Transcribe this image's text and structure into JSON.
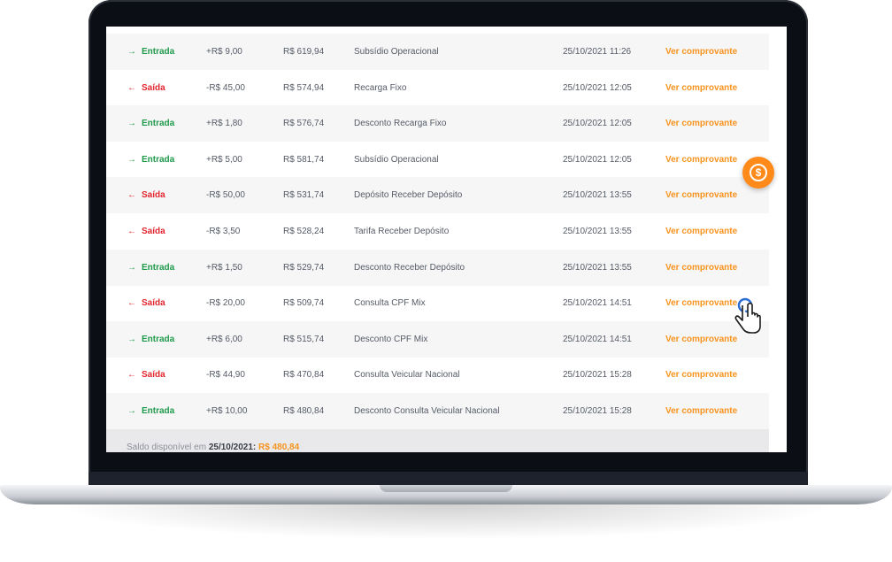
{
  "transactions": [
    {
      "type": "Entrada",
      "direction": "in",
      "arrow": "→",
      "value": "+R$ 9,00",
      "balance": "R$ 619,94",
      "description": "Subsídio Operacional",
      "date": "25/10/2021 11:26",
      "link": "Ver comprovante"
    },
    {
      "type": "Saída",
      "direction": "out",
      "arrow": "←",
      "value": "-R$ 45,00",
      "balance": "R$ 574,94",
      "description": "Recarga Fixo",
      "date": "25/10/2021 12:05",
      "link": "Ver comprovante"
    },
    {
      "type": "Entrada",
      "direction": "in",
      "arrow": "→",
      "value": "+R$ 1,80",
      "balance": "R$ 576,74",
      "description": "Desconto Recarga Fixo",
      "date": "25/10/2021 12:05",
      "link": "Ver comprovante"
    },
    {
      "type": "Entrada",
      "direction": "in",
      "arrow": "→",
      "value": "+R$ 5,00",
      "balance": "R$ 581,74",
      "description": "Subsídio Operacional",
      "date": "25/10/2021 12:05",
      "link": "Ver comprovante"
    },
    {
      "type": "Saída",
      "direction": "out",
      "arrow": "←",
      "value": "-R$ 50,00",
      "balance": "R$ 531,74",
      "description": "Depósito Receber Depósito",
      "date": "25/10/2021 13:55",
      "link": "Ver comprovante"
    },
    {
      "type": "Saída",
      "direction": "out",
      "arrow": "←",
      "value": "-R$ 3,50",
      "balance": "R$ 528,24",
      "description": "Tarifa Receber Depósito",
      "date": "25/10/2021 13:55",
      "link": "Ver comprovante"
    },
    {
      "type": "Entrada",
      "direction": "in",
      "arrow": "→",
      "value": "+R$ 1,50",
      "balance": "R$ 529,74",
      "description": "Desconto Receber Depósito",
      "date": "25/10/2021 13:55",
      "link": "Ver comprovante"
    },
    {
      "type": "Saída",
      "direction": "out",
      "arrow": "←",
      "value": "-R$ 20,00",
      "balance": "R$ 509,74",
      "description": "Consulta CPF Mix",
      "date": "25/10/2021 14:51",
      "link": "Ver comprovante"
    },
    {
      "type": "Entrada",
      "direction": "in",
      "arrow": "→",
      "value": "+R$ 6,00",
      "balance": "R$ 515,74",
      "description": "Desconto CPF Mix",
      "date": "25/10/2021 14:51",
      "link": "Ver comprovante"
    },
    {
      "type": "Saída",
      "direction": "out",
      "arrow": "←",
      "value": "-R$ 44,90",
      "balance": "R$ 470,84",
      "description": "Consulta Veicular Nacional",
      "date": "25/10/2021 15:28",
      "link": "Ver comprovante"
    },
    {
      "type": "Entrada",
      "direction": "in",
      "arrow": "→",
      "value": "+R$ 10,00",
      "balance": "R$ 480,84",
      "description": "Desconto Consulta Veicular Nacional",
      "date": "25/10/2021 15:28",
      "link": "Ver comprovante"
    }
  ],
  "footer": {
    "label": "Saldo disponível em ",
    "date": "25/10/2021",
    "separator": ": ",
    "amount": "R$ 480,84"
  },
  "fab": {
    "icon": "dollar-icon",
    "glyph": "$"
  },
  "colors": {
    "accent": "#f7931e",
    "in": "#1f9a4a",
    "out": "#e3262f"
  }
}
